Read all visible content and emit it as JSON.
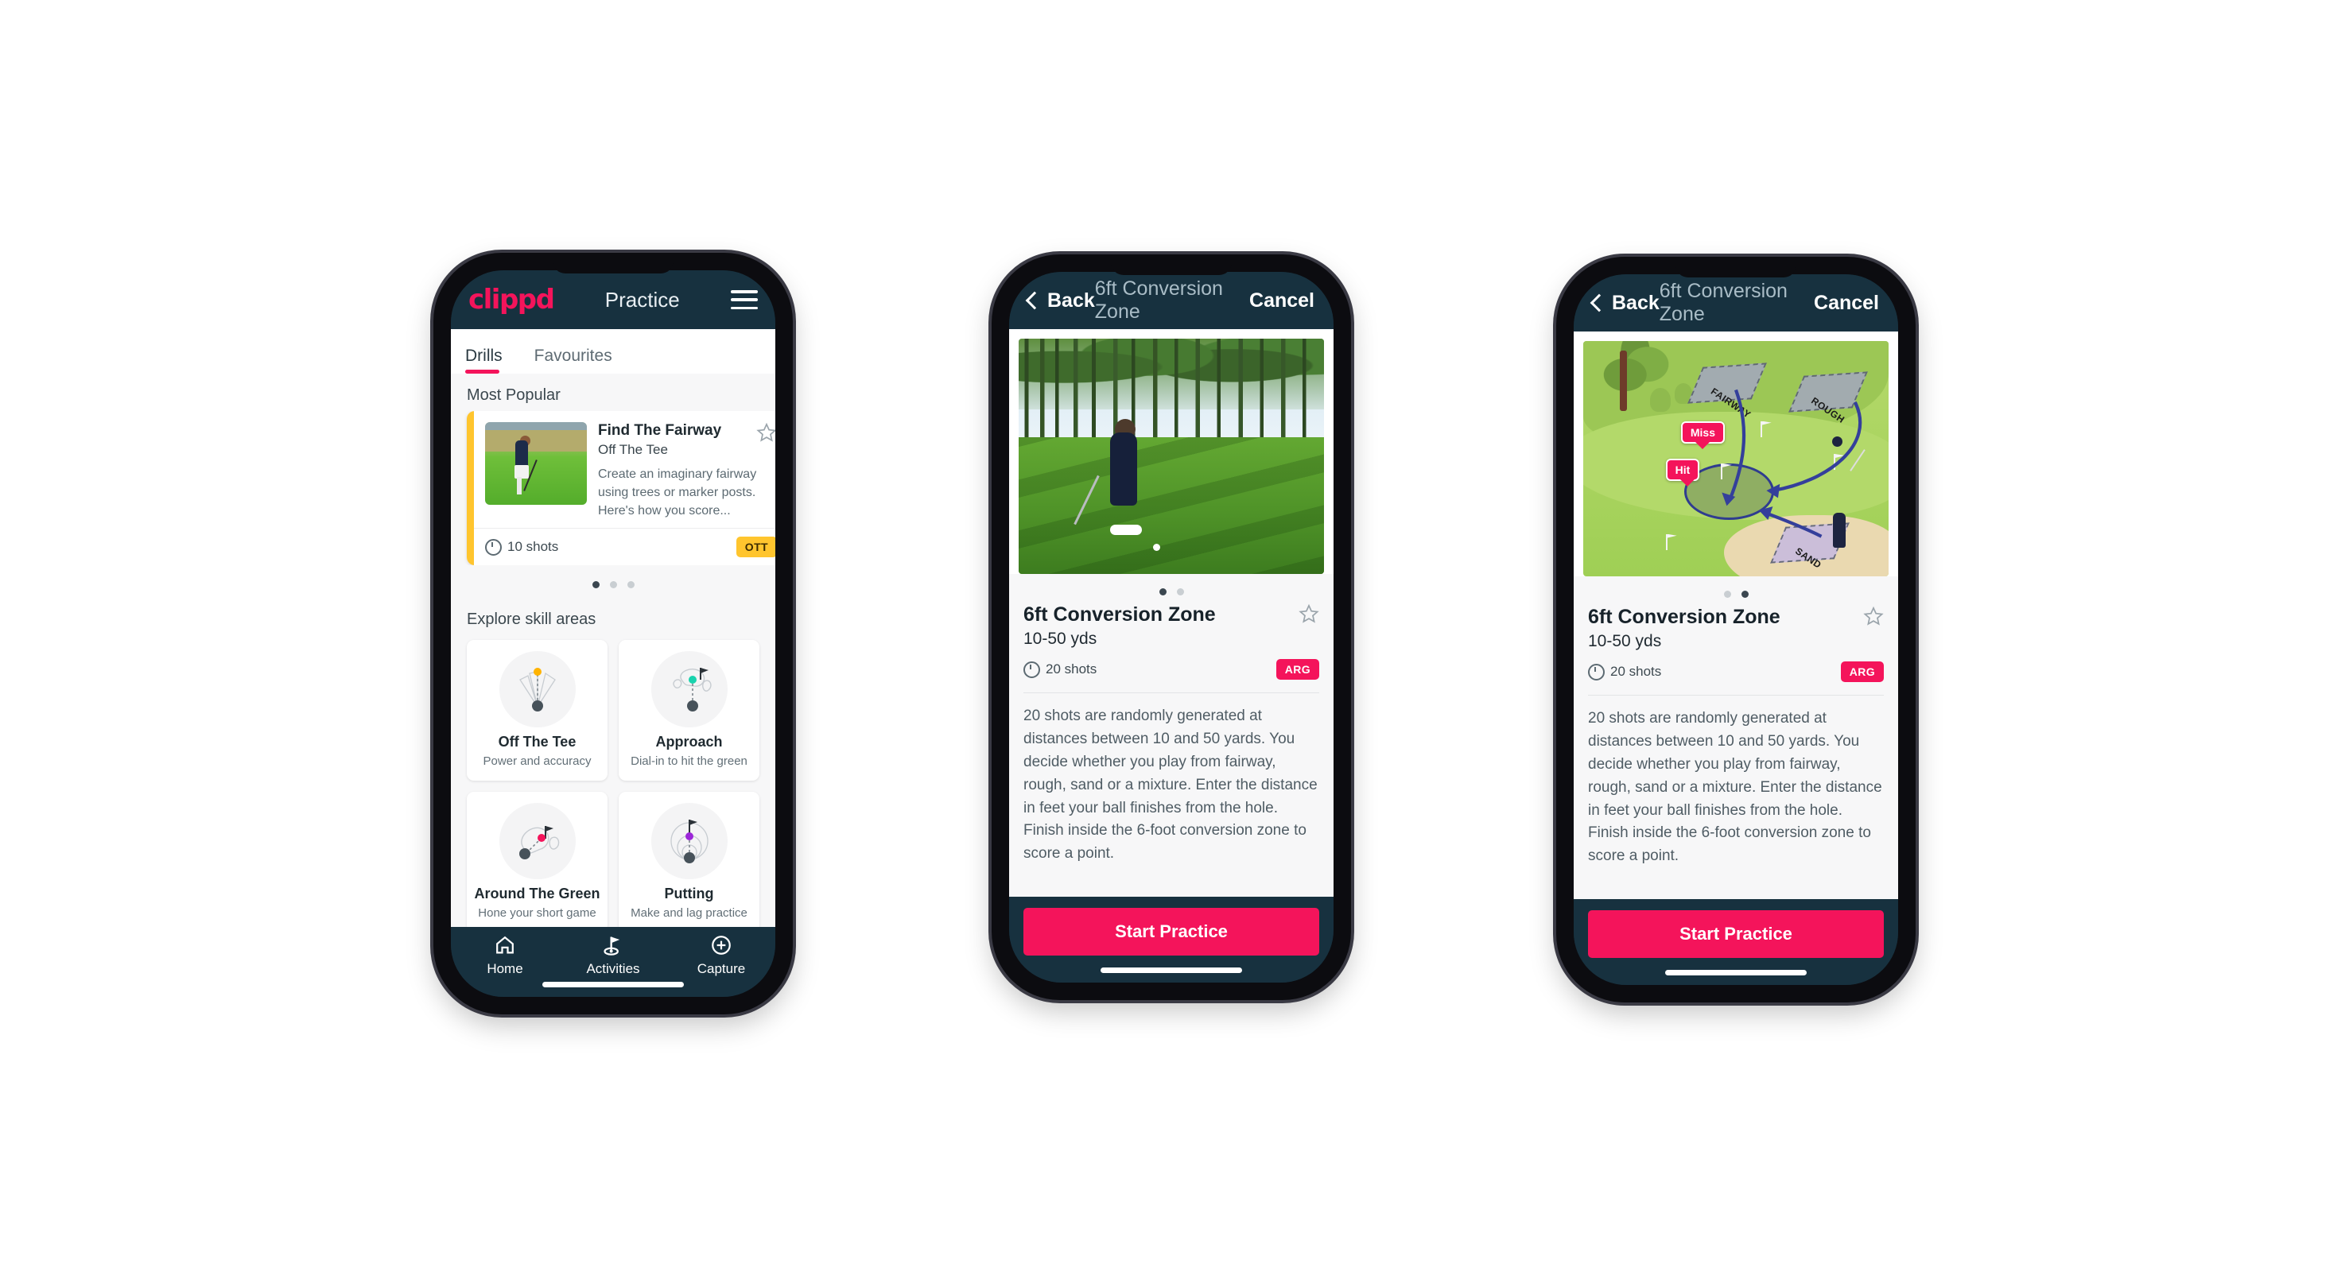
{
  "phone1": {
    "topbar": {
      "brand": "clippd",
      "title": "Practice",
      "menu_icon": "hamburger-menu-icon"
    },
    "tabs": [
      {
        "label": "Drills",
        "active": true
      },
      {
        "label": "Favourites",
        "active": false
      }
    ],
    "section_popular": "Most Popular",
    "drill_card": {
      "title": "Find The Fairway",
      "subtitle": "Off The Tee",
      "description": "Create an imaginary fairway using trees or marker posts. Here's how you score...",
      "shots": "10 shots",
      "chip": "OTT",
      "accent_color": "#ffc52e",
      "next_accent_color": "#2fd3c0",
      "star_icon": "star-outline-icon",
      "clock_icon": "clock-icon"
    },
    "carousel_dots": {
      "count": 3,
      "active": 1
    },
    "section_skills": "Explore skill areas",
    "skills": [
      {
        "name": "Off The Tee",
        "desc": "Power and accuracy",
        "icon": "tee-dispersion-icon",
        "dot_color": "#ffb300"
      },
      {
        "name": "Approach",
        "desc": "Dial-in to hit the green",
        "icon": "approach-green-icon",
        "dot_color": "#19d3ae"
      },
      {
        "name": "Around The Green",
        "desc": "Hone your short game",
        "icon": "around-green-icon",
        "dot_color": "#f4145b"
      },
      {
        "name": "Putting",
        "desc": "Make and lag practice",
        "icon": "putting-rings-icon",
        "dot_color": "#9c27d8"
      }
    ],
    "tabbar": [
      {
        "label": "Home",
        "icon": "home-icon",
        "active": false
      },
      {
        "label": "Activities",
        "icon": "golf-flag-icon",
        "active": true
      },
      {
        "label": "Capture",
        "icon": "plus-circle-icon",
        "active": false
      }
    ]
  },
  "phone2": {
    "navbar": {
      "back": "Back",
      "title": "6ft Conversion Zone",
      "cancel": "Cancel",
      "back_icon": "chevron-left-icon"
    },
    "hero": "golfer-chipping-photo",
    "dots": {
      "count": 2,
      "active": 1
    },
    "title": "6ft Conversion Zone",
    "yards": "10-50 yds",
    "shots": "20 shots",
    "chip": "ARG",
    "star_icon": "star-outline-icon",
    "clock_icon": "clock-icon",
    "description": "20 shots are randomly generated at distances between 10 and 50 yards. You decide whether you play from fairway, rough, sand or a mixture. Enter the distance in feet your ball finishes from the hole. Finish inside the 6-foot conversion zone to score a point.",
    "cta": "Start Practice"
  },
  "phone3": {
    "navbar": {
      "back": "Back",
      "title": "6ft Conversion Zone",
      "cancel": "Cancel",
      "back_icon": "chevron-left-icon"
    },
    "hero": "hole-diagram-illustration",
    "hero_labels": {
      "fairway": "FAIRWAY",
      "rough": "ROUGH",
      "sand": "SAND",
      "miss": "Miss",
      "hit": "Hit"
    },
    "dots": {
      "count": 2,
      "active": 2
    },
    "title": "6ft Conversion Zone",
    "yards": "10-50 yds",
    "shots": "20 shots",
    "chip": "ARG",
    "star_icon": "star-outline-icon",
    "clock_icon": "clock-icon",
    "description": "20 shots are randomly generated at distances between 10 and 50 yards. You decide whether you play from fairway, rough, sand or a mixture. Enter the distance in feet your ball finishes from the hole. Finish inside the 6-foot conversion zone to score a point.",
    "cta": "Start Practice"
  },
  "colors": {
    "brand_pink": "#f4145b",
    "navy": "#17313f",
    "chip_yellow": "#ffc52e",
    "teal": "#2fd3c0"
  }
}
